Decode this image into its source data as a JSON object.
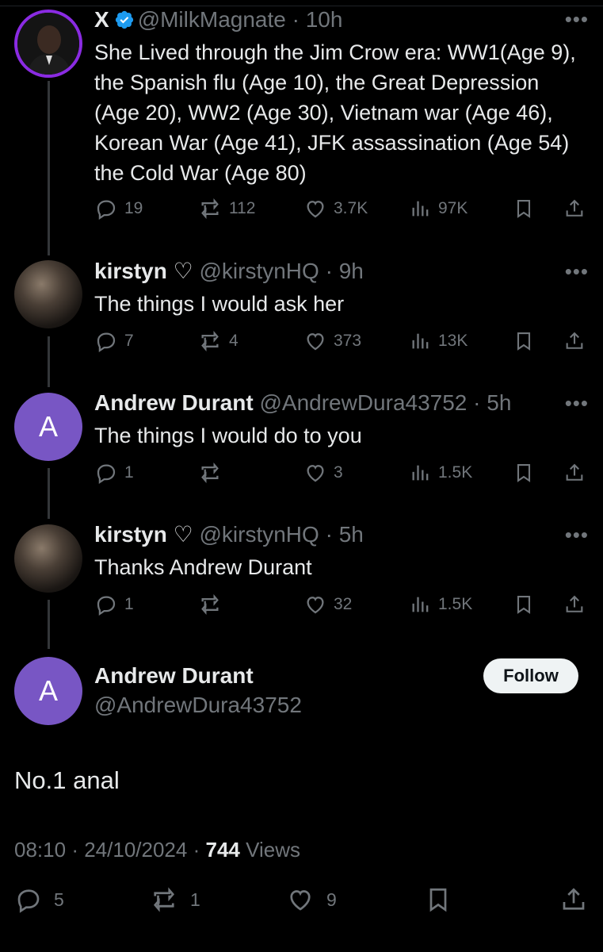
{
  "colors": {
    "background": "#000000",
    "text": "#e7e9ea",
    "muted": "#71767b",
    "avatar_letter_bg": "#7856c4",
    "ring": "#8a2be2",
    "verified": "#1d9bf0"
  },
  "replies": [
    {
      "name": "X",
      "verified": true,
      "handle": "@MilkMagnate",
      "time": "10h",
      "text": "She Lived through the Jim Crow era: WW1(Age 9), the Spanish flu (Age 10), the Great Depression (Age 20), WW2 (Age 30), Vietnam war (Age 46), Korean War (Age 41), JFK assassination (Age 54) the Cold War (Age 80)",
      "replies_count": "19",
      "reposts_count": "112",
      "likes_count": "3.7K",
      "views_count": "97K"
    },
    {
      "name": "kirstyn ♡",
      "handle": "@kirstynHQ",
      "time": "9h",
      "text": "The things I would ask her",
      "replies_count": "7",
      "reposts_count": "4",
      "likes_count": "373",
      "views_count": "13K"
    },
    {
      "name": "Andrew Durant",
      "handle": "@AndrewDura43752",
      "time": "5h",
      "avatar_letter": "A",
      "text": "The things I would do to you",
      "replies_count": "1",
      "reposts_count": "",
      "likes_count": "3",
      "views_count": "1.5K"
    },
    {
      "name": "kirstyn ♡",
      "handle": "@kirstynHQ",
      "time": "5h",
      "text": "Thanks Andrew Durant",
      "replies_count": "1",
      "reposts_count": "",
      "likes_count": "32",
      "views_count": "1.5K"
    }
  ],
  "separator": "·",
  "main": {
    "avatar_letter": "A",
    "name": "Andrew Durant",
    "handle": "@AndrewDura43752",
    "follow_label": "Follow",
    "text": "No.1 anal",
    "time": "08:10",
    "date": "24/10/2024",
    "views": "744",
    "views_label": "Views",
    "replies_count": "5",
    "reposts_count": "1",
    "likes_count": "9"
  },
  "icons": [
    "reply-icon",
    "repost-icon",
    "like-icon",
    "views-icon",
    "bookmark-icon",
    "share-icon",
    "more-icon",
    "verified-icon"
  ]
}
